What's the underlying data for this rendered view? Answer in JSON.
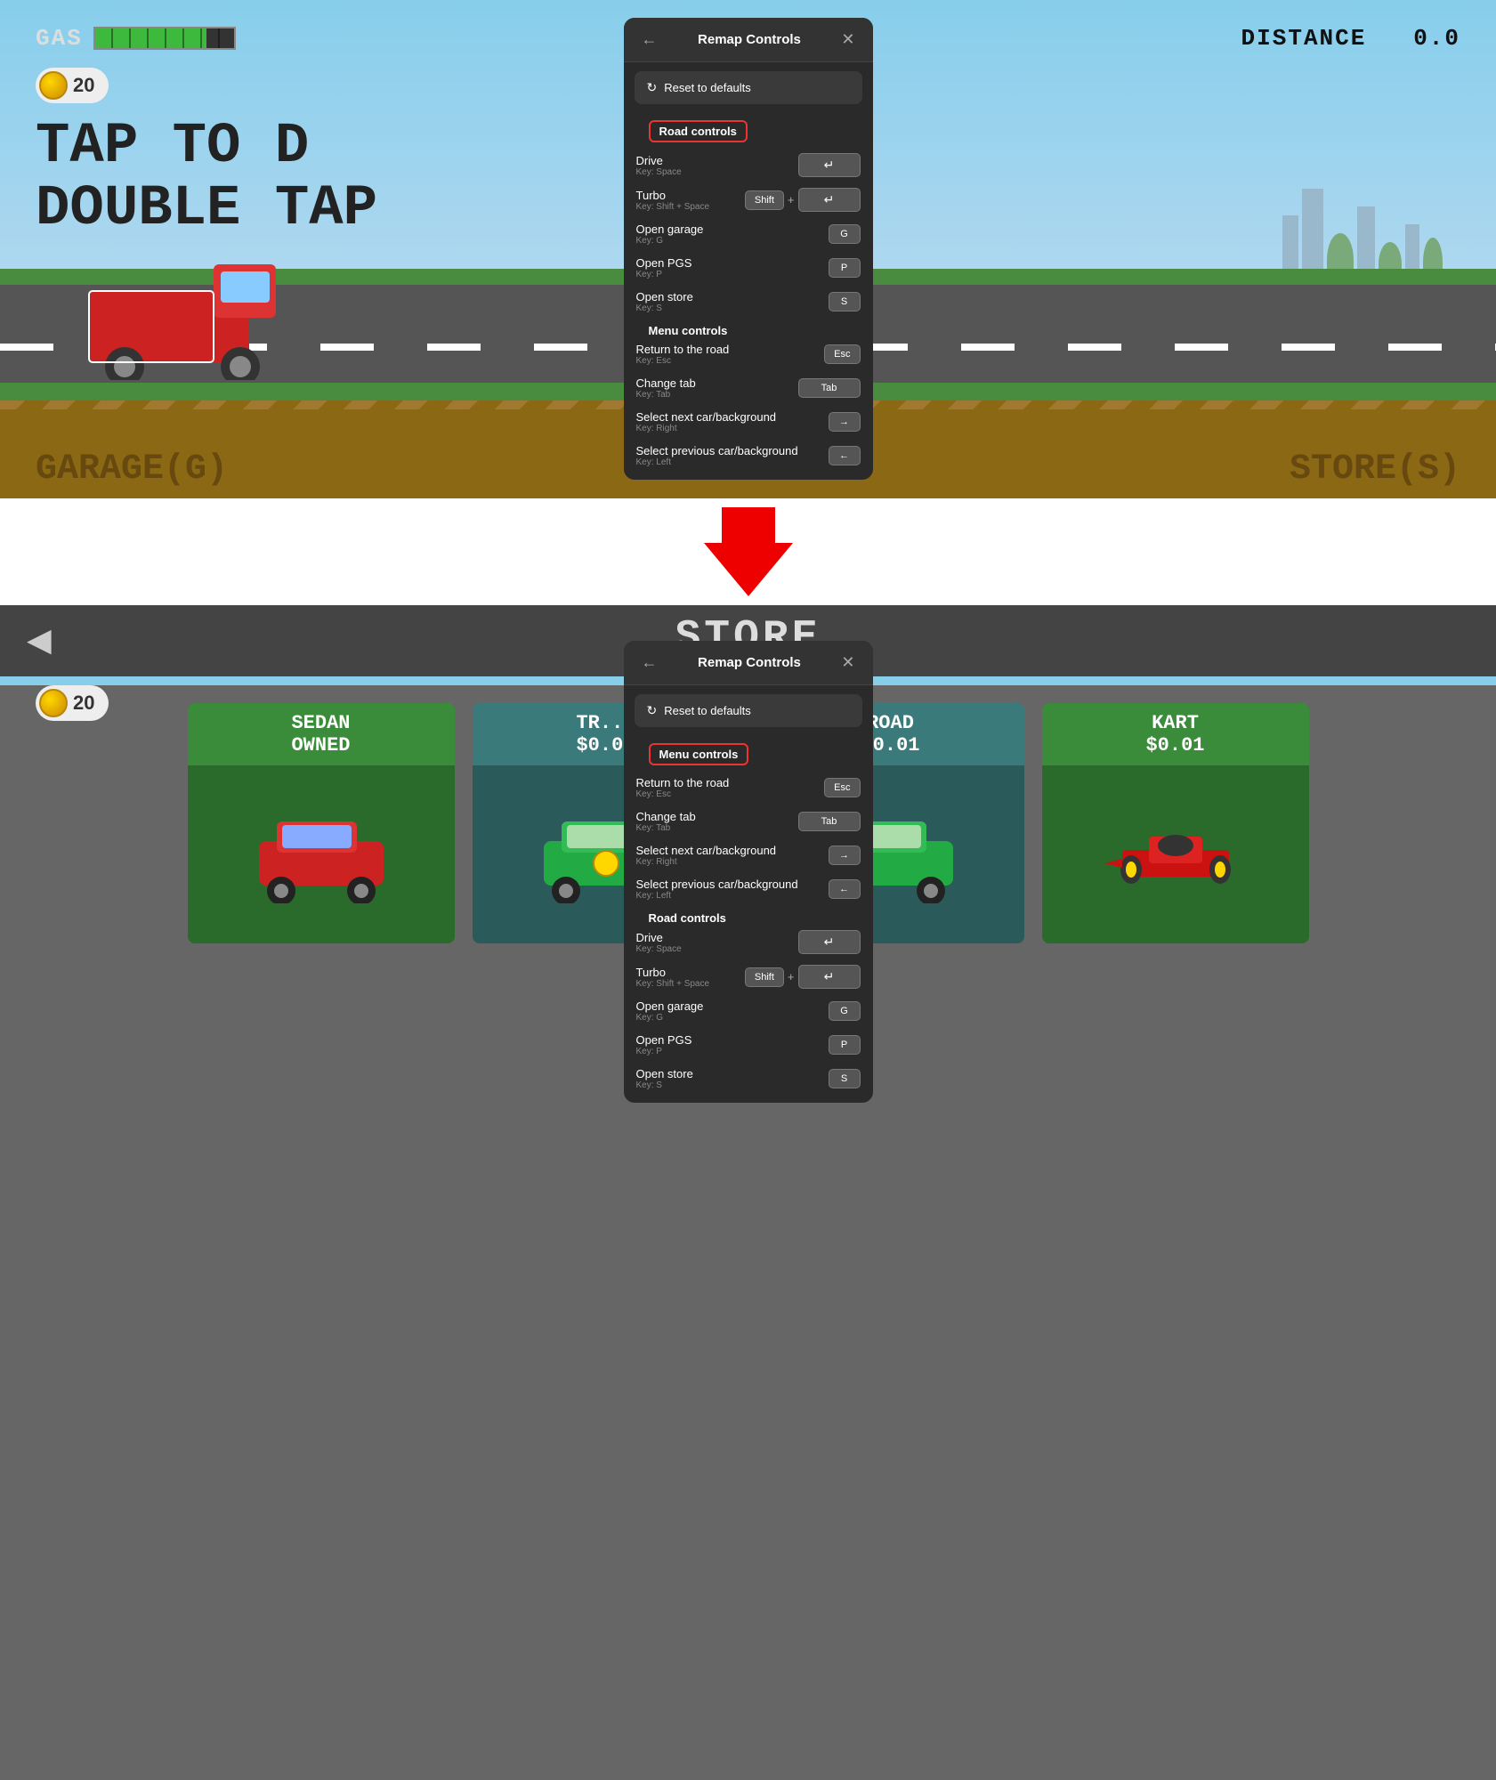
{
  "top": {
    "hud": {
      "gas_label": "GAS",
      "distance_label": "DISTANCE",
      "distance_value": "0.0",
      "coins": "20"
    },
    "game_text": {
      "line1": "TAP TO D",
      "line2": "DOUBLE TAP"
    },
    "corner_labels": {
      "left": "GARAGE(G)",
      "right": "STORE(S)"
    }
  },
  "modal_top": {
    "title": "Remap Controls",
    "reset_label": "Reset to defaults",
    "road_section": "Road controls",
    "road_section_highlighted": true,
    "controls_road": [
      {
        "name": "Drive",
        "key_label": "Key: Space",
        "keys": [
          {
            "symbol": "↵",
            "wide": true
          }
        ]
      },
      {
        "name": "Turbo",
        "key_label": "Key: Shift + Space",
        "keys": [
          {
            "symbol": "Shift",
            "wide": false
          },
          "+",
          {
            "symbol": "↵",
            "wide": true
          }
        ]
      },
      {
        "name": "Open garage",
        "key_label": "Key: G",
        "keys": [
          {
            "symbol": "G",
            "wide": false
          }
        ]
      },
      {
        "name": "Open PGS",
        "key_label": "Key: P",
        "keys": [
          {
            "symbol": "P",
            "wide": false
          }
        ]
      },
      {
        "name": "Open store",
        "key_label": "Key: S",
        "keys": [
          {
            "symbol": "S",
            "wide": false
          }
        ]
      }
    ],
    "menu_section": "Menu controls",
    "controls_menu": [
      {
        "name": "Return to the road",
        "key_label": "Key: Esc",
        "keys": [
          {
            "symbol": "Esc",
            "wide": false
          }
        ]
      },
      {
        "name": "Change tab",
        "key_label": "Key: Tab",
        "keys": [
          {
            "symbol": "Tab",
            "wide": true
          }
        ]
      },
      {
        "name": "Select next car/background",
        "key_label": "Key: Right",
        "keys": [
          {
            "symbol": "→",
            "wide": false
          }
        ]
      },
      {
        "name": "Select previous car/background",
        "key_label": "Key: Left",
        "keys": [
          {
            "symbol": "←",
            "wide": false
          }
        ]
      }
    ]
  },
  "divider": {
    "arrow": "▼"
  },
  "bottom": {
    "store_title": "STORE",
    "coins": "20",
    "cars": [
      {
        "name": "SEDAN\nOWNED",
        "price": null,
        "theme": "green-bg"
      },
      {
        "name": "TR...\n...",
        "price": "$0.01",
        "theme": "teal-bg"
      },
      {
        "name": "ROAD\n$0.01",
        "price": "$0.01",
        "theme": "teal-bg"
      },
      {
        "name": "KART\n$0.01",
        "price": "$0.01",
        "theme": "kart-bg"
      }
    ]
  },
  "modal_bottom": {
    "title": "Remap Controls",
    "reset_label": "Reset to defaults",
    "menu_section": "Menu controls",
    "menu_section_highlighted": true,
    "controls_menu": [
      {
        "name": "Return to the road",
        "key_label": "Key: Esc",
        "keys": [
          {
            "symbol": "Esc",
            "wide": false
          }
        ]
      },
      {
        "name": "Change tab",
        "key_label": "Key: Tab",
        "keys": [
          {
            "symbol": "Tab",
            "wide": true
          }
        ]
      },
      {
        "name": "Select next car/background",
        "key_label": "Key: Right",
        "keys": [
          {
            "symbol": "→",
            "wide": false
          }
        ]
      },
      {
        "name": "Select previous car/background",
        "key_label": "Key: Left",
        "keys": [
          {
            "symbol": "←",
            "wide": false
          }
        ]
      }
    ],
    "road_section": "Road controls",
    "controls_road": [
      {
        "name": "Drive",
        "key_label": "Key: Space",
        "keys": [
          {
            "symbol": "↵",
            "wide": true
          }
        ]
      },
      {
        "name": "Turbo",
        "key_label": "Key: Shift + Space",
        "keys": [
          {
            "symbol": "Shift",
            "wide": false
          },
          "+",
          {
            "symbol": "↵",
            "wide": true
          }
        ]
      },
      {
        "name": "Open garage",
        "key_label": "Key: G",
        "keys": [
          {
            "symbol": "G",
            "wide": false
          }
        ]
      },
      {
        "name": "Open PGS",
        "key_label": "Key: P",
        "keys": [
          {
            "symbol": "P",
            "wide": false
          }
        ]
      },
      {
        "name": "Open store",
        "key_label": "Key: S",
        "keys": [
          {
            "symbol": "S",
            "wide": false
          }
        ]
      }
    ]
  }
}
